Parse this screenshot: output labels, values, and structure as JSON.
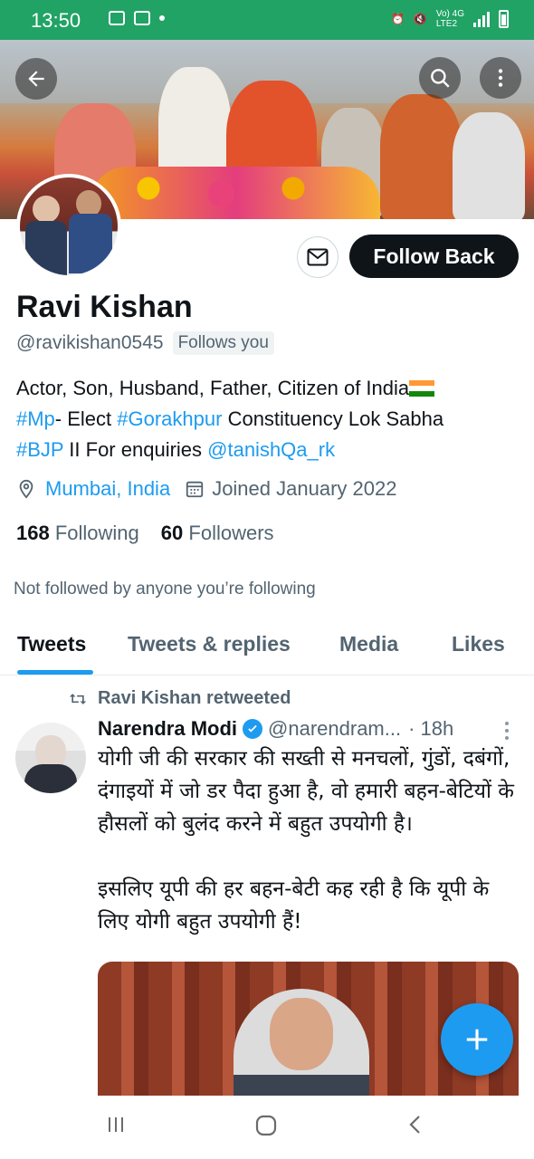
{
  "status_bar": {
    "time": "13:50",
    "network_label": "Vo) 4G",
    "network_sub": "LTE2"
  },
  "profile": {
    "name": "Ravi Kishan",
    "handle": "@ravikishan0545",
    "follows_you": "Follows you",
    "follow_back_label": "Follow Back",
    "bio_line1": "Actor, Son, Husband, Father, Citizen of India",
    "bio_tag1": "#Mp",
    "bio_text2": "- Elect ",
    "bio_tag2": "#Gorakhpur",
    "bio_text3": " Constituency Lok Sabha",
    "bio_tag3": "#BJP",
    "bio_text4": " II For enquiries ",
    "bio_mention": "@tanishQa_rk",
    "location": "Mumbai, India",
    "joined": "Joined January 2022",
    "following_count": "168",
    "following_label": "Following",
    "followers_count": "60",
    "followers_label": "Followers",
    "not_followed": "Not followed by anyone you’re following"
  },
  "tabs": [
    {
      "label": "Tweets"
    },
    {
      "label": "Tweets & replies"
    },
    {
      "label": "Media"
    },
    {
      "label": "Likes"
    }
  ],
  "tweet": {
    "retweeted_by": "Ravi Kishan retweeted",
    "author_name": "Narendra Modi",
    "author_handle": "@narendram...",
    "time": "· 18h",
    "text": "योगी जी की सरकार की सख्ती से मनचलों, गुंडों, दबंगों, दंगाइयों में जो डर पैदा हुआ है, वो हमारी बहन-बेटियों के हौसलों को बुलंद करने में बहुत उपयोगी है।\n\nइसलिए यूपी की हर बहन-बेटी कह रही है कि यूपी के लिए योगी बहुत उपयोगी हैं!"
  },
  "icons": {
    "back": "arrow-left-icon",
    "search": "search-icon",
    "more": "more-vertical-icon",
    "message": "envelope-icon",
    "location": "location-pin-icon",
    "calendar": "calendar-icon",
    "retweet": "retweet-icon",
    "verified": "verified-badge-icon",
    "compose": "plus-icon"
  },
  "colors": {
    "status_bar": "#21a366",
    "accent": "#1d9bf0",
    "follow_button": "#0f1419"
  }
}
